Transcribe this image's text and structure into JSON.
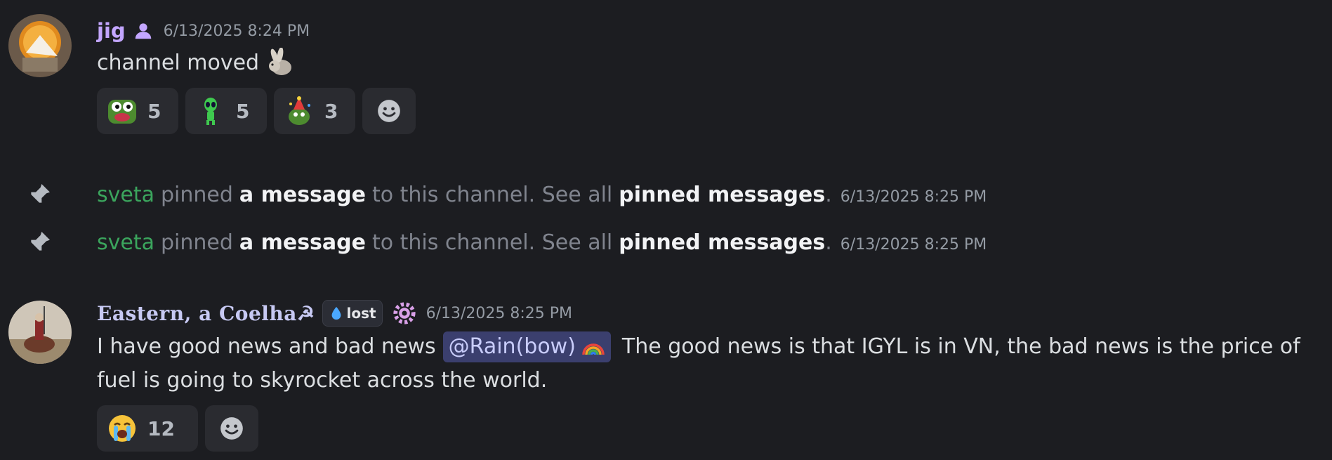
{
  "messages": [
    {
      "author": "jig",
      "author_color": "#c3a6ff",
      "author_icon": "person-icon",
      "timestamp": "6/13/2025 8:24 PM",
      "text": "channel moved",
      "inline_emoji": "bunny-emoji",
      "reactions": [
        {
          "emoji": "pepe-frog-emoji",
          "count": "5"
        },
        {
          "emoji": "green-alien-emoji",
          "count": "5"
        },
        {
          "emoji": "party-pepe-emoji",
          "count": "3"
        }
      ],
      "add_reaction_icon": "smiley-add-icon"
    },
    {
      "author": "Eastern, a Coelha☭",
      "badge": {
        "icon": "droplet-icon",
        "label": "lost"
      },
      "role_icon": "gear-flower-icon",
      "timestamp": "6/13/2025 8:25 PM",
      "text_before": "I have good news and bad news",
      "mention": "@Rain(bow)",
      "mention_emoji": "rainbow-emoji",
      "text_after": "The good news is that IGYL is in VN, the bad news is the price of",
      "text_line2": "fuel is going to skyrocket across the world.",
      "reactions": [
        {
          "emoji": "loudly-crying-face-emoji",
          "count": "12"
        }
      ],
      "add_reaction_icon": "smiley-add-icon"
    }
  ],
  "system_messages": [
    {
      "user": "sveta",
      "verb": "pinned",
      "link1": "a message",
      "middle": "to this channel. See all",
      "link2": "pinned messages",
      "end": ".",
      "timestamp": "6/13/2025 8:25 PM",
      "icon": "pin-icon"
    },
    {
      "user": "sveta",
      "verb": "pinned",
      "link1": "a message",
      "middle": "to this channel. See all",
      "link2": "pinned messages",
      "end": ".",
      "timestamp": "6/13/2025 8:25 PM",
      "icon": "pin-icon"
    }
  ],
  "colors": {
    "background": "#1c1d21",
    "system_user": "#3ba55d",
    "mention_bg": "#3b3f6e"
  }
}
